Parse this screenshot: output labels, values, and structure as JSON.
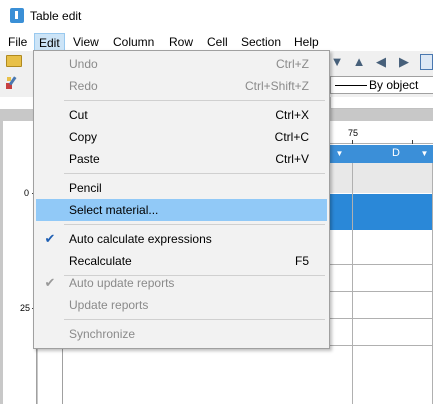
{
  "window": {
    "title": "Table edit",
    "icon": "table-edit-app-icon"
  },
  "menubar": {
    "items": [
      {
        "label": "File"
      },
      {
        "label": "Edit",
        "active": true
      },
      {
        "label": "View"
      },
      {
        "label": "Column"
      },
      {
        "label": "Row"
      },
      {
        "label": "Cell"
      },
      {
        "label": "Section"
      },
      {
        "label": "Help"
      }
    ]
  },
  "toolbar": {
    "by_object_label": "By object",
    "icons": [
      "folder-icon",
      "paint-brush-icon",
      "arrow-down-icon",
      "arrow-up-icon",
      "arrow-left-icon",
      "arrow-right-icon",
      "grid-edge-icon"
    ]
  },
  "ruler": {
    "top_label": "75",
    "left_labels": [
      "0",
      "25"
    ]
  },
  "grid": {
    "column_letter": "D",
    "header_color": "#3b8fd8",
    "selected_band_color": "#2a88d8"
  },
  "edit_menu": {
    "items": [
      {
        "label": "Undo",
        "shortcut": "Ctrl+Z",
        "enabled": false
      },
      {
        "label": "Redo",
        "shortcut": "Ctrl+Shift+Z",
        "enabled": false
      },
      {
        "label": "Cut",
        "shortcut": "Ctrl+X",
        "enabled": true
      },
      {
        "label": "Copy",
        "shortcut": "Ctrl+C",
        "enabled": true
      },
      {
        "label": "Paste",
        "shortcut": "Ctrl+V",
        "enabled": true
      },
      {
        "label": "Pencil",
        "shortcut": "",
        "enabled": true
      },
      {
        "label": "Select material...",
        "shortcut": "",
        "enabled": true,
        "highlighted": true
      },
      {
        "label": "Auto calculate expressions",
        "shortcut": "",
        "enabled": true,
        "checked": true
      },
      {
        "label": "Recalculate",
        "shortcut": "F5",
        "enabled": true
      },
      {
        "label": "Auto update reports",
        "shortcut": "",
        "enabled": false,
        "checked": true
      },
      {
        "label": "Update reports",
        "shortcut": "",
        "enabled": false
      },
      {
        "label": "Synchronize",
        "shortcut": "",
        "enabled": false
      }
    ],
    "highlight_color": "#91c9f7",
    "check_color": "#1e5fb3"
  }
}
